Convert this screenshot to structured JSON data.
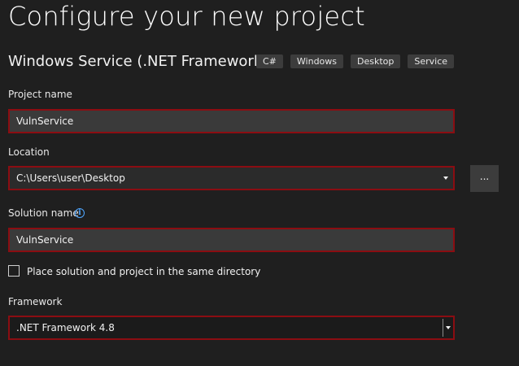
{
  "page": {
    "title": "Configure your new project",
    "template_name": "Windows Service (.NET Framework)",
    "tags": [
      "C#",
      "Windows",
      "Desktop",
      "Service"
    ]
  },
  "form": {
    "project_name": {
      "label": "Project name",
      "value": "VulnService"
    },
    "location": {
      "label": "Location",
      "value": "C:\\Users\\user\\Desktop",
      "browse_label": "..."
    },
    "solution_name": {
      "label": "Solution name",
      "value": "VulnService",
      "info_icon": "i"
    },
    "same_directory": {
      "label": "Place solution and project in the same directory",
      "checked": false
    },
    "framework": {
      "label": "Framework",
      "value": ".NET Framework 4.8"
    }
  },
  "colors": {
    "background": "#1f1f1f",
    "field_bg": "#3a3a3a",
    "highlight_border": "#8b0d12",
    "tag_bg": "#3c3c3c",
    "info_blue": "#4ea6ff"
  }
}
